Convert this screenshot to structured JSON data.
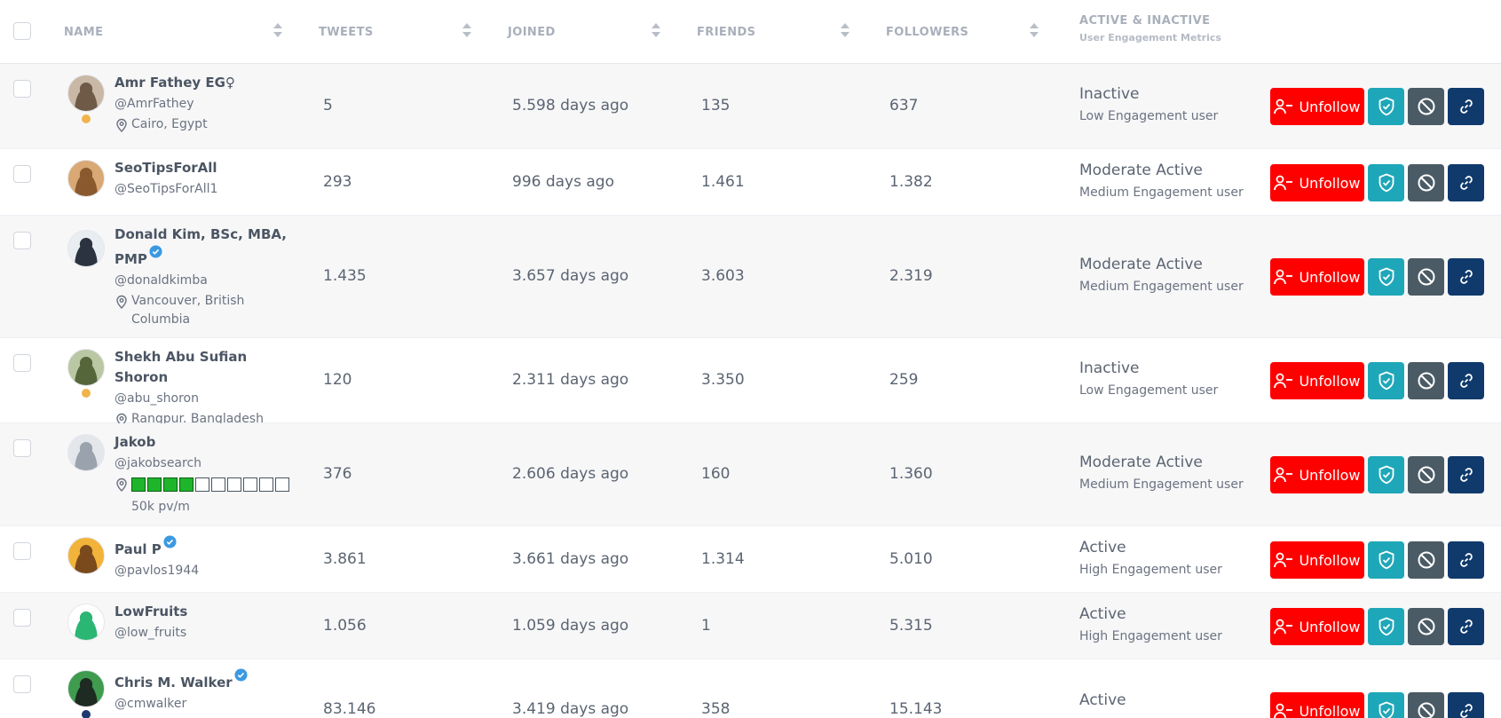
{
  "header": {
    "columns": [
      "NAME",
      "TWEETS",
      "JOINED",
      "FRIENDS",
      "FOLLOWERS"
    ],
    "activity_title": "ACTIVE & INACTIVE",
    "activity_subtitle": "User Engagement Metrics"
  },
  "actions": {
    "unfollow_label": "Unfollow"
  },
  "colors": {
    "unfollow": "#ff0000",
    "shield": "#1ea7b8",
    "block": "#4b5b65",
    "link": "#0f3a6b",
    "verified": "#3b99e0"
  },
  "rows": [
    {
      "name": "Amr Fathey EG♀",
      "handle": "@AmrFathey",
      "location": "Cairo, Egypt",
      "tweets": "5",
      "joined": "5.598 days ago",
      "friends": "135",
      "followers": "637",
      "status": "Inactive",
      "engagement": "Low Engagement user",
      "dot": "#f0b44c"
    },
    {
      "name": "SeoTipsForAll",
      "handle": "@SeoTipsForAll1",
      "tweets": "293",
      "joined": "996 days ago",
      "friends": "1.461",
      "followers": "1.382",
      "status": "Moderate Active",
      "engagement": "Medium Engagement user"
    },
    {
      "name": "Donald Kim, BSc, MBA, PMP",
      "handle": "@donaldkimba",
      "location": "Vancouver, British Columbia",
      "tweets": "1.435",
      "joined": "3.657 days ago",
      "friends": "3.603",
      "followers": "2.319",
      "status": "Moderate Active",
      "engagement": "Medium Engagement user",
      "verified": true
    },
    {
      "name": "Shekh Abu Sufian Shoron",
      "handle": "@abu_shoron",
      "location": "Rangpur. Bangladesh",
      "tweets": "120",
      "joined": "2.311 days ago",
      "friends": "3.350",
      "followers": "259",
      "status": "Inactive",
      "engagement": "Low Engagement user",
      "dot": "#f0b44c"
    },
    {
      "name": "Jakob",
      "handle": "@jakobsearch",
      "location_gauge": {
        "filled": 4,
        "total": 10
      },
      "location_suffix": "50k pv/m",
      "tweets": "376",
      "joined": "2.606 days ago",
      "friends": "160",
      "followers": "1.360",
      "status": "Moderate Active",
      "engagement": "Medium Engagement user"
    },
    {
      "name": "Paul P",
      "handle": "@pavlos1944",
      "tweets": "3.861",
      "joined": "3.661 days ago",
      "friends": "1.314",
      "followers": "5.010",
      "status": "Active",
      "engagement": "High Engagement user",
      "verified": true
    },
    {
      "name": "LowFruits",
      "handle": "@low_fruits",
      "tweets": "1.056",
      "joined": "1.059 days ago",
      "friends": "1",
      "followers": "5.315",
      "status": "Active",
      "engagement": "High Engagement user"
    },
    {
      "name": "Chris M. Walker",
      "handle": "@cmwalker",
      "tweets": "83.146",
      "joined": "3.419 days ago",
      "friends": "358",
      "followers": "15.143",
      "status": "Active",
      "engagement": "",
      "verified": true,
      "dot": "#1e3a6e"
    }
  ]
}
